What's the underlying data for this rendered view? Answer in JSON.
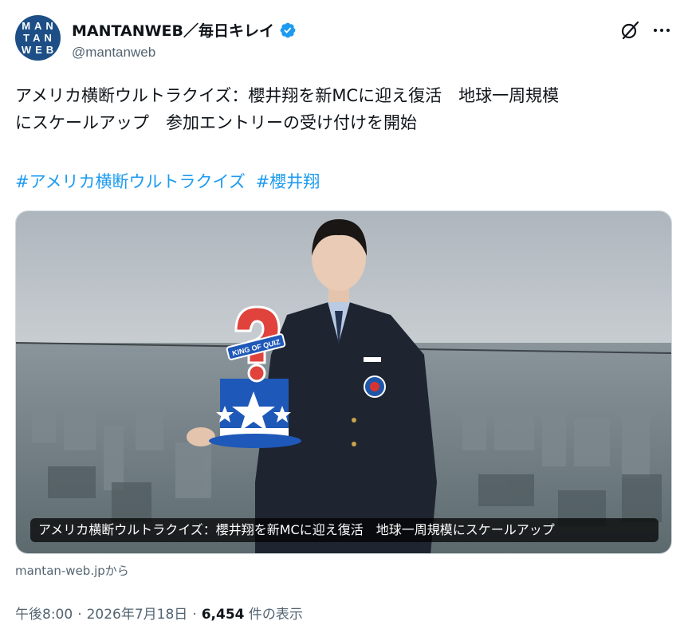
{
  "author": {
    "display_name": "MANTANWEB／毎日キレイ",
    "handle": "@mantanweb",
    "avatar_letters": [
      "MAN",
      "TAN",
      "WEB"
    ],
    "verified_color": "#1d9bf0"
  },
  "header_icons": {
    "grok": "grok-icon",
    "more": "more-icon"
  },
  "tweet": {
    "text": "アメリカ横断ウルトラクイズ：櫻井翔を新MCに迎え復活　地球一周規模\nにスケールアップ　参加エントリーの受け付けを開始",
    "hashtags": [
      "#アメリカ横断ウルトラクイズ",
      "#櫻井翔"
    ]
  },
  "card": {
    "caption": "アメリカ横断ウルトラクイズ：櫻井翔を新MCに迎え復活　地球一周規模にスケールアップ",
    "hat_banner": "KING OF QUIZ",
    "source": "mantan-web.jpから"
  },
  "meta": {
    "time": "午後8:00",
    "sep1": "·",
    "date": "2026年7月18日",
    "sep2": "·",
    "views_count": "6,454",
    "views_label": "件の表示"
  },
  "colors": {
    "accent": "#1d9bf0",
    "text": "#0f1419",
    "muted": "#536471"
  }
}
